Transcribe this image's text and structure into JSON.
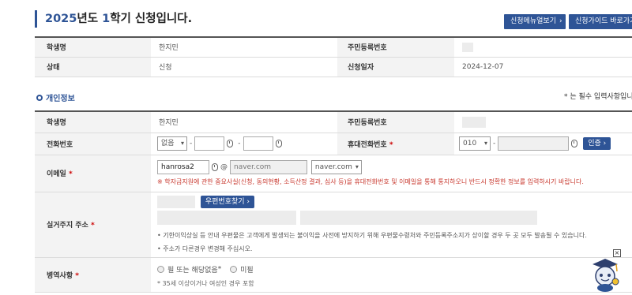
{
  "header": {
    "title_year": "2025",
    "title_mid": "년도 ",
    "title_term": "1",
    "title_rest": "학기 신청입니다.",
    "btn_manual": "신청메뉴얼보기",
    "btn_guide": "신청가이드 바로가기"
  },
  "summary": {
    "name_label": "학생명",
    "name_value": "한지민",
    "rrn_label": "주민등록번호",
    "status_label": "상태",
    "status_value": "신청",
    "date_label": "신청일자",
    "date_value": "2024-12-07"
  },
  "personal": {
    "section_title": "개인정보",
    "required_note": "* 는 필수 입력사항입니",
    "name_label": "학생명",
    "name_value": "한지민",
    "rrn_label": "주민등록번호",
    "phone_label": "전화번호",
    "phone_prefix": "없음",
    "mobile_label": "휴대전화번호",
    "mobile_prefix": "010",
    "verify_btn": "인증",
    "email_label": "이메일",
    "email_id": "hanrosa2",
    "email_at": "@",
    "email_domain": "naver.com",
    "email_domain_select": "naver.com",
    "email_warning": "※ 학자금지원에 관한 중요사실(신청, 동의현황, 소득산정 결과, 심사 등)을 휴대전화번호 및 이메일을 통해 통지하오니 반드시 정확한 정보를 입력하시기 바랍니다.",
    "address_label": "실거주지 주소",
    "zip_btn": "우편번호찾기",
    "address_note1": "기한이익상실 등 안내 우편물은 고객에게 발생되는 불이익을 사전에 방지하기 위해 우편물수령처와 주민등록주소지가 상이할 경우 두 곳 모두 발송될 수 있습니다.",
    "address_note2": "주소가 다른경우 변경해 주십시오.",
    "military_label": "병역사항",
    "military_opt1": "필 또는 해당없음",
    "military_opt1_star": "*",
    "military_opt2": "미필",
    "military_note": "* 35세 이상이거나 여성인 경우 포함"
  },
  "colors": {
    "accent": "#2e5496",
    "warning": "#c8372d",
    "header_bg": "#f3f3f3"
  }
}
